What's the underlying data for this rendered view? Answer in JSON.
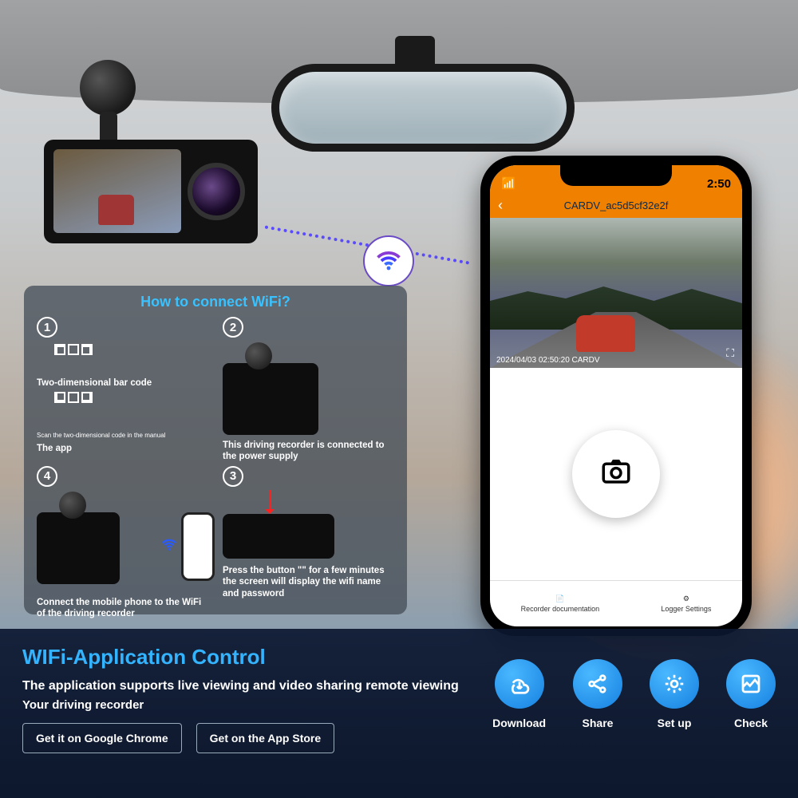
{
  "panel": {
    "title": "How to connect WiFi?",
    "step1_num": "1",
    "step1_caption": "Two-dimensional bar code",
    "step1_sub_a": "Scan the two-dimensional code in the manual",
    "step1_sub_b": "The app",
    "step2_num": "2",
    "step2_caption": "This driving recorder is connected to the power supply",
    "step3_num": "3",
    "step3_caption": "Press the button \"\" for a few minutes the screen will display the wifi name and password",
    "step4_num": "4",
    "step4_caption": "Connect the mobile phone to the WiFi of the driving recorder"
  },
  "phone": {
    "time": "2:50",
    "device_name": "CARDV_ac5d5cf32e2f",
    "live_meta": "2024/04/03  02:50:20 CARDV",
    "tab1": "Recorder documentation",
    "tab2": "Logger Settings"
  },
  "footer": {
    "title": "WIFi-Application Control",
    "line1": "The application supports live viewing and video sharing remote viewing",
    "line2": "Your driving recorder",
    "btn1": "Get it on Google Chrome",
    "btn2": "Get on the App Store",
    "icon1": "Download",
    "icon2": "Share",
    "icon3": "Set up",
    "icon4": "Check"
  }
}
